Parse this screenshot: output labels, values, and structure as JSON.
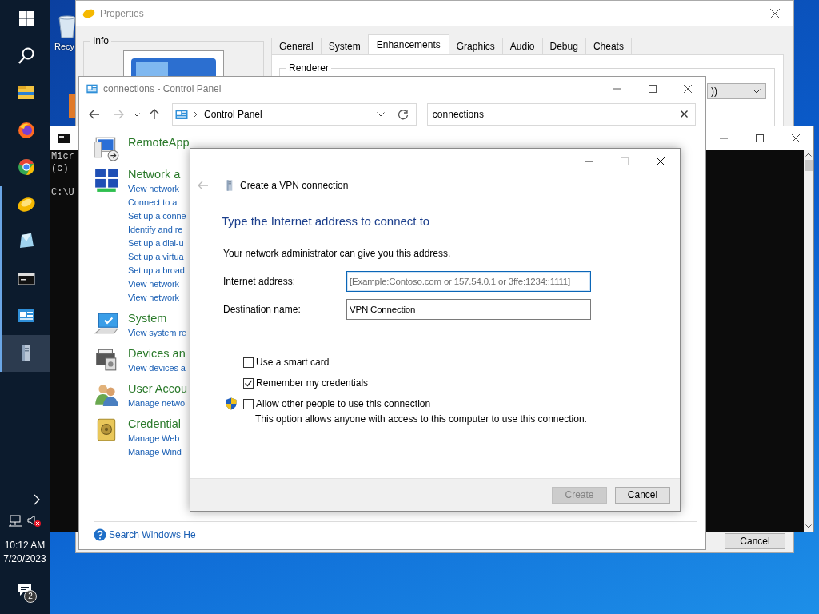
{
  "taskbar": {
    "apps": [
      {
        "kind": "start",
        "running": false,
        "selected": false
      },
      {
        "kind": "search",
        "running": false,
        "selected": false
      },
      {
        "kind": "explorer",
        "running": false,
        "selected": false
      },
      {
        "kind": "firefox",
        "running": false,
        "selected": false
      },
      {
        "kind": "chrome",
        "running": false,
        "selected": false
      },
      {
        "kind": "coin",
        "running": true,
        "selected": false
      },
      {
        "kind": "glass",
        "running": true,
        "selected": false
      },
      {
        "kind": "console",
        "running": true,
        "selected": false
      },
      {
        "kind": "control-panel",
        "running": true,
        "selected": false
      },
      {
        "kind": "tower",
        "running": true,
        "selected": true
      }
    ],
    "tray": {
      "time": "10:12 AM",
      "date": "7/20/2023",
      "notifications": "2"
    }
  },
  "desktop_icons": [
    {
      "label": "Recy"
    }
  ],
  "properties_window": {
    "title": "Properties",
    "info_group": "Info",
    "tabs": [
      {
        "label": "General",
        "selected": false
      },
      {
        "label": "System",
        "selected": false
      },
      {
        "label": "Enhancements",
        "selected": true
      },
      {
        "label": "Graphics",
        "selected": false
      },
      {
        "label": "Audio",
        "selected": false
      },
      {
        "label": "Debug",
        "selected": false
      },
      {
        "label": "Cheats",
        "selected": false
      }
    ],
    "renderer_group": "Renderer",
    "renderer_dropdown": "))",
    "buttons": [
      "Cancel"
    ]
  },
  "console_window": {
    "output": "Micr\n(c)\n\nC:\\U"
  },
  "control_panel": {
    "title": "connections - Control Panel",
    "address": "Control Panel",
    "search": "connections",
    "categories": [
      {
        "kind": "remoteapp",
        "title": "RemoteApp"
      },
      {
        "kind": "network",
        "title": "Network a",
        "links": [
          "View network",
          "Connect to a",
          "Set up a conne",
          "Identify and re",
          "Set up a dial-u",
          "Set up a virtua",
          "Set up a broad",
          "View network",
          "View network"
        ]
      },
      {
        "kind": "system",
        "title": "System",
        "links": [
          "View system re"
        ]
      },
      {
        "kind": "devices",
        "title": "Devices an",
        "links": [
          "View devices a"
        ]
      },
      {
        "kind": "users",
        "title": "User Accou",
        "links": [
          "Manage netwo"
        ]
      },
      {
        "kind": "credential",
        "title": "Credential",
        "links": [
          "Manage Web",
          "Manage Wind"
        ]
      }
    ],
    "help_link": "Search Windows He"
  },
  "vpn_dialog": {
    "title": "Create a VPN connection",
    "heading": "Type the Internet address to connect to",
    "intro": "Your network administrator can give you this address.",
    "fields": [
      {
        "label": "Internet address:",
        "placeholder": "[Example:Contoso.com or 157.54.0.1 or 3ffe:1234::1111]",
        "focused": true
      },
      {
        "label": "Destination name:",
        "value": "VPN Connection",
        "focused": false
      }
    ],
    "options": [
      {
        "label": "Use a smart card",
        "checked": false,
        "shield": false
      },
      {
        "label": "Remember my credentials",
        "checked": true,
        "shield": false
      },
      {
        "label": "Allow other people to use this connection",
        "checked": false,
        "shield": true
      }
    ],
    "note": "This option allows anyone with access to this computer to use this connection.",
    "buttons": [
      {
        "label": "Create",
        "disabled": true
      },
      {
        "label": "Cancel",
        "disabled": false
      }
    ]
  }
}
